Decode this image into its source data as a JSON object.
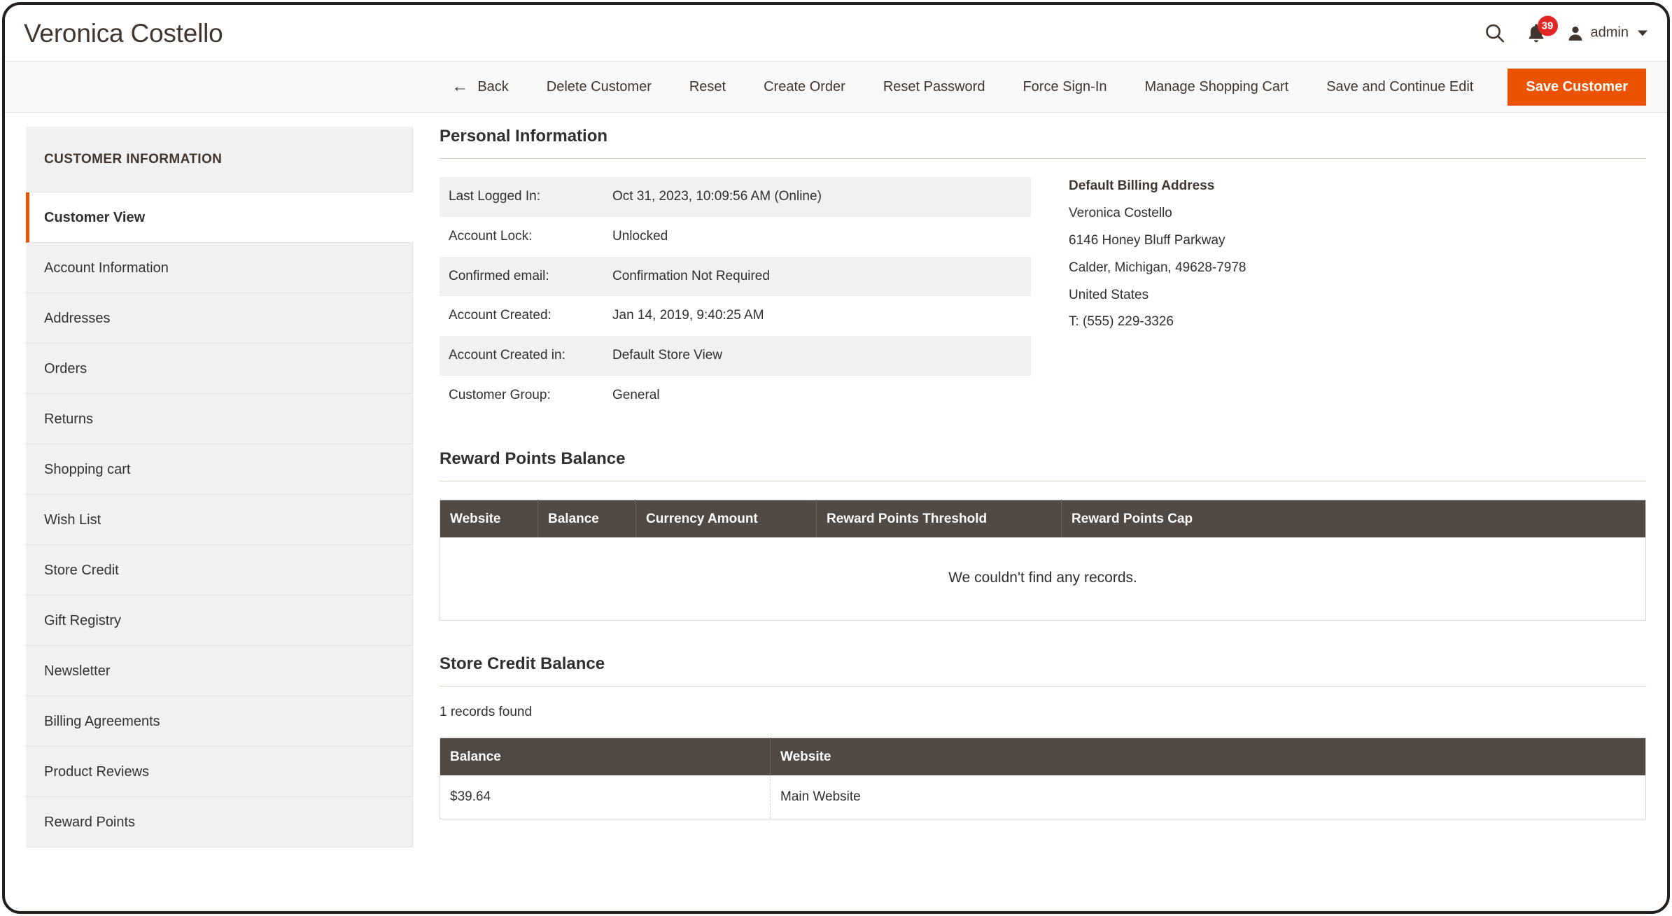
{
  "header": {
    "title": "Veronica Costello",
    "search_icon": "search-icon",
    "notifications_icon": "bell-icon",
    "notifications_count": "39",
    "user_icon": "user-avatar-icon",
    "user_name": "admin",
    "caret_icon": "chevron-down-icon"
  },
  "toolbar": {
    "back_arrow": "←",
    "back": "Back",
    "delete_customer": "Delete Customer",
    "reset": "Reset",
    "create_order": "Create Order",
    "reset_password": "Reset Password",
    "force_sign_in": "Force Sign-In",
    "manage_shopping_cart": "Manage Shopping Cart",
    "save_and_continue_edit": "Save and Continue Edit",
    "save_customer": "Save Customer",
    "primary_color": "#eb5202"
  },
  "sidebar": {
    "title": "CUSTOMER INFORMATION",
    "active_indicator_color": "#eb5202",
    "items": [
      {
        "label": "Customer View",
        "active": true
      },
      {
        "label": "Account Information",
        "active": false
      },
      {
        "label": "Addresses",
        "active": false
      },
      {
        "label": "Orders",
        "active": false
      },
      {
        "label": "Returns",
        "active": false
      },
      {
        "label": "Shopping cart",
        "active": false
      },
      {
        "label": "Wish List",
        "active": false
      },
      {
        "label": "Store Credit",
        "active": false
      },
      {
        "label": "Gift Registry",
        "active": false
      },
      {
        "label": "Newsletter",
        "active": false
      },
      {
        "label": "Billing Agreements",
        "active": false
      },
      {
        "label": "Product Reviews",
        "active": false
      },
      {
        "label": "Reward Points",
        "active": false
      }
    ]
  },
  "personal_information": {
    "title": "Personal Information",
    "rows": [
      {
        "label": "Last Logged In:",
        "value": "Oct 31, 2023, 10:09:56 AM (Online)"
      },
      {
        "label": "Account Lock:",
        "value": "Unlocked"
      },
      {
        "label": "Confirmed email:",
        "value": "Confirmation Not Required"
      },
      {
        "label": "Account Created:",
        "value": "Jan 14, 2019, 9:40:25 AM"
      },
      {
        "label": "Account Created in:",
        "value": "Default Store View"
      },
      {
        "label": "Customer Group:",
        "value": "General"
      }
    ],
    "billing_address": {
      "title": "Default Billing Address",
      "lines": [
        "Veronica Costello",
        "6146 Honey Bluff Parkway",
        "Calder, Michigan, 49628-7978",
        "United States",
        "T: (555) 229-3326"
      ]
    }
  },
  "reward_points_balance": {
    "title": "Reward Points Balance",
    "columns": [
      "Website",
      "Balance",
      "Currency Amount",
      "Reward Points Threshold",
      "Reward Points Cap"
    ],
    "rows": [],
    "empty_message": "We couldn't find any records.",
    "header_color": "#514943"
  },
  "store_credit_balance": {
    "title": "Store Credit Balance",
    "records_found": "1 records found",
    "columns": [
      "Balance",
      "Website"
    ],
    "rows": [
      {
        "balance": "$39.64",
        "website": "Main Website"
      }
    ],
    "header_color": "#514943"
  }
}
